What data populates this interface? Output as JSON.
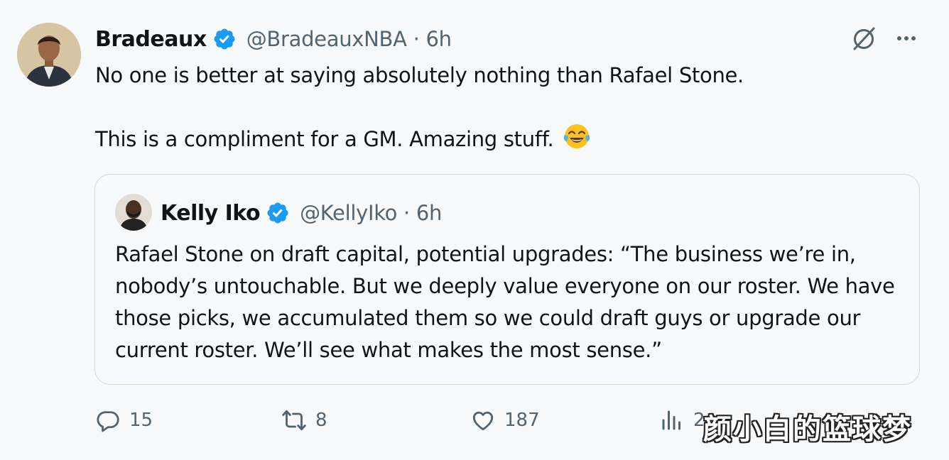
{
  "tweet": {
    "author_name": "Bradeaux",
    "author_handle": "@BradeauxNBA",
    "time": "6h",
    "line1": "No one is better at saying absolutely nothing than Rafael Stone.",
    "line2": "This is a compliment for a GM. Amazing stuff.",
    "emoji": "tears-of-joy-emoji"
  },
  "quote": {
    "author_name": "Kelly Iko",
    "author_handle": "@KellyIko",
    "time": "6h",
    "text": "Rafael Stone on draft capital, potential upgrades: “The business we’re in, nobody’s untouchable. But we deeply value everyone on our roster. We have those picks, we accumulated them so we could draft guys or upgrade our current roster. We’ll see what makes the most sense.”"
  },
  "actions": {
    "replies": "15",
    "reposts": "8",
    "likes": "187",
    "views": "2"
  },
  "watermark": "颜小白的篮球梦",
  "colors": {
    "verified": "#1d9bf0",
    "secondary_text": "#536471",
    "border": "#cfd9de"
  }
}
